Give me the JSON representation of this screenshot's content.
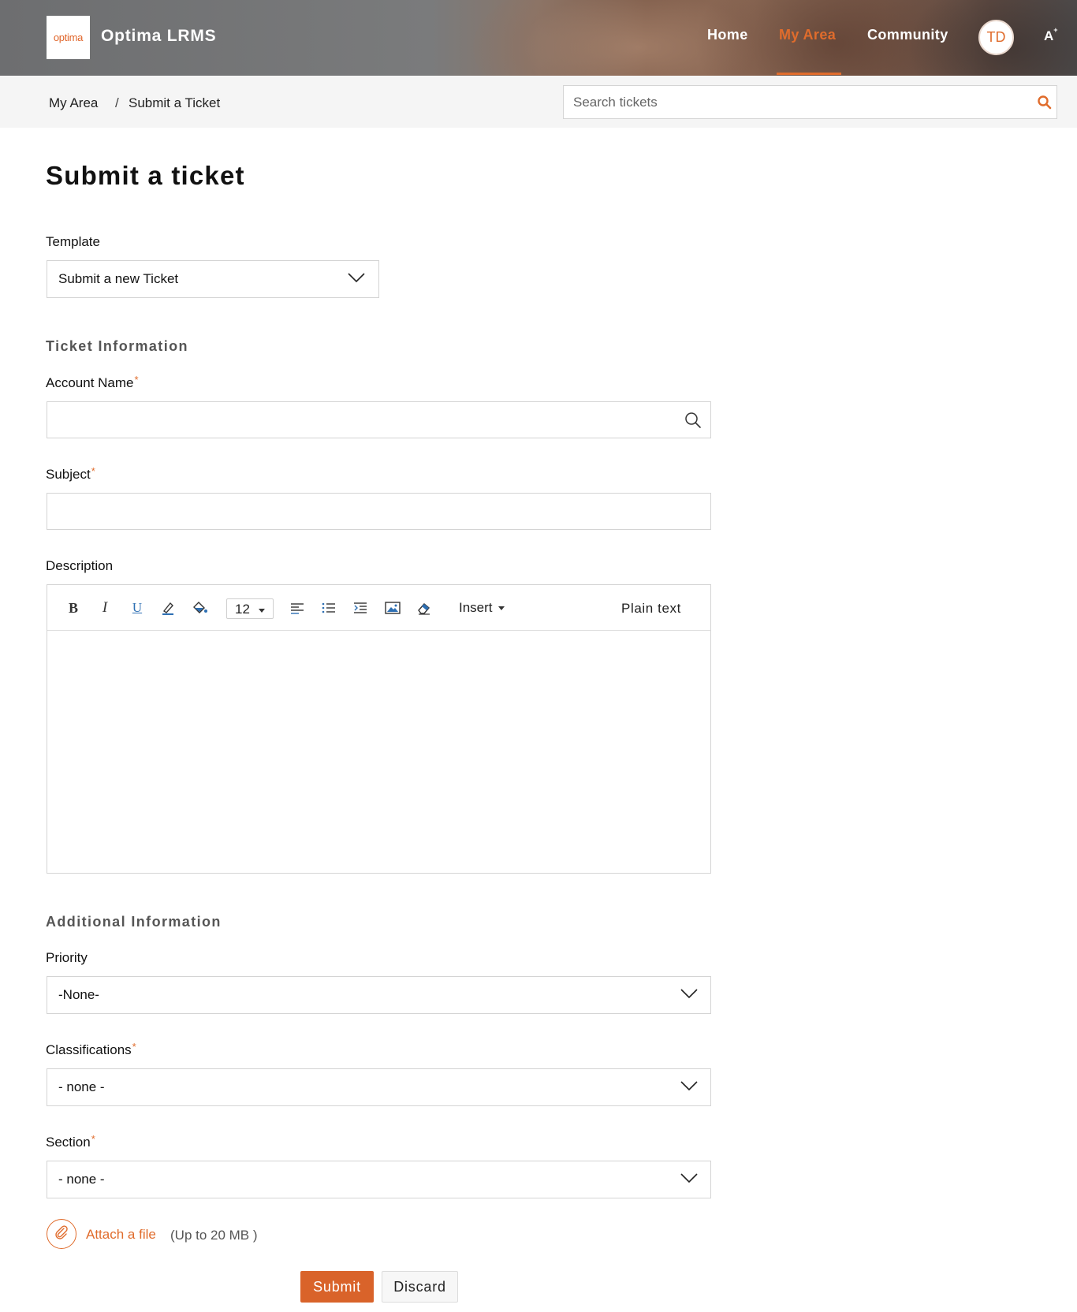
{
  "header": {
    "logo_text": "optima",
    "brand": "Optima LRMS",
    "nav": [
      {
        "label": "Home",
        "active": false
      },
      {
        "label": "My Area",
        "active": true
      },
      {
        "label": "Community",
        "active": false
      }
    ],
    "avatar_initials": "TD",
    "accessibility_label": "A",
    "accessibility_sup": "+"
  },
  "breadcrumb": {
    "items": [
      "My Area",
      "Submit a Ticket"
    ],
    "separator": "/"
  },
  "search": {
    "placeholder": "Search tickets",
    "value": ""
  },
  "form": {
    "title": "Submit a ticket",
    "template": {
      "label": "Template",
      "value": "Submit a new Ticket"
    },
    "ticket_info_title": "Ticket Information",
    "account_name": {
      "label": "Account Name",
      "required_mark": "*",
      "value": ""
    },
    "subject": {
      "label": "Subject",
      "required_mark": "*",
      "value": ""
    },
    "description": {
      "label": "Description",
      "toolbar": {
        "bold": "B",
        "italic": "I",
        "underline": "U",
        "font_size": "12",
        "insert": "Insert",
        "plain_text": "Plain text"
      }
    },
    "additional_info_title": "Additional Information",
    "priority": {
      "label": "Priority",
      "value": "-None-"
    },
    "classifications": {
      "label": "Classifications",
      "required_mark": "*",
      "value": "- none -"
    },
    "section": {
      "label": "Section",
      "required_mark": "*",
      "value": "- none -"
    },
    "attach": {
      "link": "Attach a file",
      "hint": "(Up to 20 MB )"
    },
    "submit_label": "Submit",
    "discard_label": "Discard"
  },
  "colors": {
    "accent": "#e06c2c",
    "border": "#d4d4d4",
    "subbar_bg": "#f5f5f5"
  },
  "icons": [
    "search-icon",
    "lookup-search-icon",
    "chevron-down-icon",
    "paperclip-icon",
    "highlighter-icon",
    "fill-bucket-icon",
    "align-left-icon",
    "bullet-list-icon",
    "indent-icon",
    "image-icon",
    "eraser-icon"
  ]
}
